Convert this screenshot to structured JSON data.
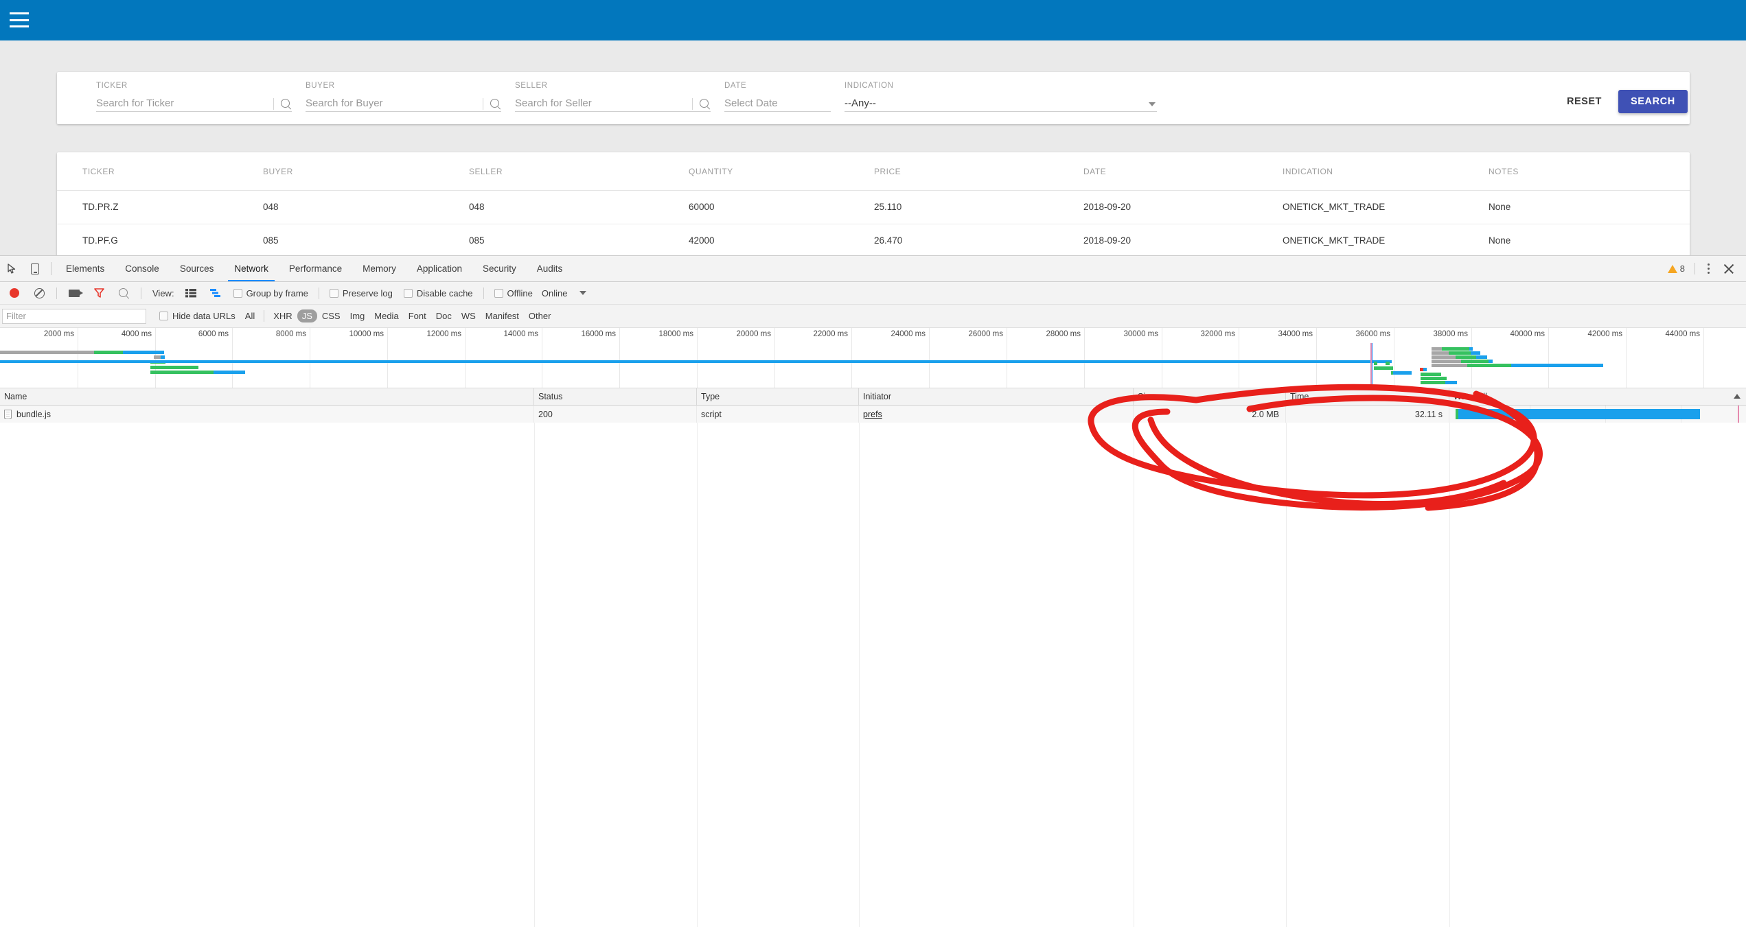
{
  "app": {
    "header": {
      "menu_icon": "hamburger-menu-icon",
      "brand_color": "#0277bd"
    },
    "search_form": {
      "fields": [
        {
          "label": "TICKER",
          "placeholder": "Search for Ticker",
          "value": "",
          "type": "search"
        },
        {
          "label": "BUYER",
          "placeholder": "Search for Buyer",
          "value": "",
          "type": "search"
        },
        {
          "label": "SELLER",
          "placeholder": "Search for Seller",
          "value": "",
          "type": "search"
        },
        {
          "label": "DATE",
          "placeholder": "Select Date",
          "value": "",
          "type": "date"
        },
        {
          "label": "INDICATION",
          "placeholder": "",
          "value": "--Any--",
          "type": "select"
        }
      ],
      "reset_label": "RESET",
      "search_label": "SEARCH",
      "search_button_color": "#3f51b5"
    },
    "results_table": {
      "columns": [
        "TICKER",
        "BUYER",
        "SELLER",
        "QUANTITY",
        "PRICE",
        "DATE",
        "INDICATION",
        "NOTES"
      ],
      "rows": [
        [
          "TD.PR.Z",
          "048",
          "048",
          "60000",
          "25.110",
          "2018-09-20",
          "ONETICK_MKT_TRADE",
          "None"
        ],
        [
          "TD.PF.G",
          "085",
          "085",
          "42000",
          "26.470",
          "2018-09-20",
          "ONETICK_MKT_TRADE",
          "None"
        ]
      ]
    }
  },
  "devtools": {
    "toolbar_icons": {
      "inspect": "cursor-inspect-icon",
      "device": "device-toolbar-icon"
    },
    "tabs": [
      {
        "label": "Elements",
        "active": false
      },
      {
        "label": "Console",
        "active": false
      },
      {
        "label": "Sources",
        "active": false
      },
      {
        "label": "Network",
        "active": true
      },
      {
        "label": "Performance",
        "active": false
      },
      {
        "label": "Memory",
        "active": false
      },
      {
        "label": "Application",
        "active": false
      },
      {
        "label": "Security",
        "active": false
      },
      {
        "label": "Audits",
        "active": false
      }
    ],
    "warning_count": "8",
    "network_toolbar": {
      "record_icon": "record-button-icon",
      "clear_icon": "clear-icon",
      "screenshot_icon": "capture-screenshots-icon",
      "filter_icon": "filter-funnel-icon",
      "search_icon": "search-icon",
      "view_label": "View:",
      "view_large_rows_icon": "list-view-icon",
      "view_waterfall_icon": "waterfall-view-icon",
      "group_by_frame": "Group by frame",
      "preserve_log": "Preserve log",
      "disable_cache": "Disable cache",
      "offline": "Offline",
      "throttling": "Online"
    },
    "filter_bar": {
      "filter_placeholder": "Filter",
      "filter_value": "",
      "hide_data_urls": "Hide data URLs",
      "types": [
        {
          "label": "All",
          "selected": false
        },
        {
          "label": "XHR",
          "selected": false
        },
        {
          "label": "JS",
          "selected": true
        },
        {
          "label": "CSS",
          "selected": false
        },
        {
          "label": "Img",
          "selected": false
        },
        {
          "label": "Media",
          "selected": false
        },
        {
          "label": "Font",
          "selected": false
        },
        {
          "label": "Doc",
          "selected": false
        },
        {
          "label": "WS",
          "selected": false
        },
        {
          "label": "Manifest",
          "selected": false
        },
        {
          "label": "Other",
          "selected": false
        }
      ]
    },
    "overview": {
      "ticks": [
        "2000 ms",
        "4000 ms",
        "6000 ms",
        "8000 ms",
        "10000 ms",
        "12000 ms",
        "14000 ms",
        "16000 ms",
        "18000 ms",
        "20000 ms",
        "22000 ms",
        "24000 ms",
        "26000 ms",
        "28000 ms",
        "30000 ms",
        "32000 ms",
        "34000 ms",
        "36000 ms",
        "38000 ms",
        "40000 ms",
        "42000 ms",
        "44000 ms"
      ]
    },
    "requests_table": {
      "columns": [
        "Name",
        "Status",
        "Type",
        "Initiator",
        "Size",
        "Time",
        "Waterfall"
      ],
      "rows": [
        {
          "name": "bundle.js",
          "status": "200",
          "type": "script",
          "initiator": "prefs",
          "size": "2.0 MB",
          "time": "32.11 s",
          "icon": "script-file-icon"
        }
      ]
    },
    "annotation": {
      "shape": "hand-drawn-red-ellipse",
      "color": "#e8201b",
      "target": "size-and-time-cells"
    }
  }
}
